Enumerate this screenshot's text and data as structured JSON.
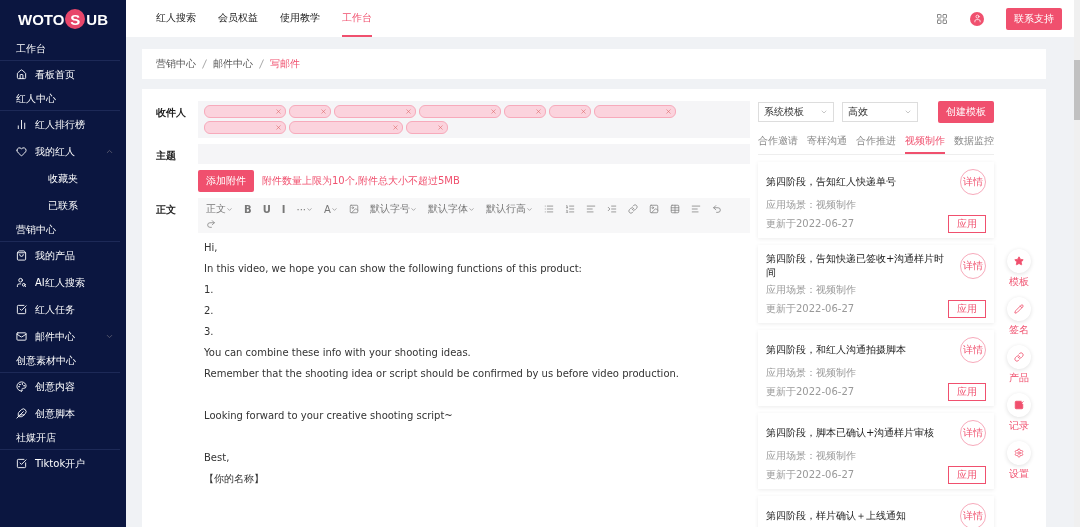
{
  "sidebar": {
    "logo": {
      "before": "WOTO",
      "mark": "S",
      "after": "UB"
    },
    "sections": [
      {
        "title": "工作台",
        "items": [
          {
            "label": "看板首页"
          }
        ]
      },
      {
        "title": "红人中心",
        "items": [
          {
            "label": "红人排行榜"
          },
          {
            "label": "我的红人",
            "expanded": true,
            "children": [
              {
                "label": "收藏夹"
              },
              {
                "label": "已联系"
              }
            ]
          }
        ]
      },
      {
        "title": "营销中心",
        "items": [
          {
            "label": "我的产品"
          },
          {
            "label": "AI红人搜索"
          },
          {
            "label": "红人任务"
          },
          {
            "label": "邮件中心",
            "expanded": false
          }
        ]
      },
      {
        "title": "创意素材中心",
        "items": [
          {
            "label": "创意内容"
          },
          {
            "label": "创意脚本"
          }
        ]
      },
      {
        "title": "社媒开店",
        "items": [
          {
            "label": "Tiktok开户"
          }
        ]
      }
    ]
  },
  "top_nav": {
    "tabs": [
      {
        "label": "红人搜索",
        "selected": false
      },
      {
        "label": "会员权益",
        "selected": false
      },
      {
        "label": "使用教学",
        "selected": false
      },
      {
        "label": "工作台",
        "selected": true
      }
    ],
    "support_button": "联系支持"
  },
  "breadcrumb": [
    "营销中心",
    "邮件中心",
    "写邮件"
  ],
  "form": {
    "recipients_label": "收件人",
    "subject_label": "主题",
    "attach_button": "添加附件",
    "attach_hint": "附件数量上限为10个,附件总大小不超过5MB",
    "body_label": "正文",
    "toolbar": [
      {
        "kind": "drop",
        "label": "正文"
      },
      {
        "kind": "text",
        "label": "B"
      },
      {
        "kind": "text",
        "label": "U"
      },
      {
        "kind": "text",
        "label": "I"
      },
      {
        "kind": "drop",
        "label": "···"
      },
      {
        "kind": "drop",
        "label": "A"
      },
      {
        "kind": "icon"
      },
      {
        "kind": "drop",
        "label": "默认字号"
      },
      {
        "kind": "drop",
        "label": "默认字体"
      },
      {
        "kind": "drop",
        "label": "默认行高"
      },
      {
        "kind": "icon"
      },
      {
        "kind": "icon"
      },
      {
        "kind": "icon"
      },
      {
        "kind": "icon"
      },
      {
        "kind": "icon"
      },
      {
        "kind": "icon"
      },
      {
        "kind": "icon"
      },
      {
        "kind": "icon"
      },
      {
        "kind": "icon"
      },
      {
        "kind": "icon"
      }
    ],
    "body_blocks": [
      [
        "Hi,",
        "In this video, we hope you can show the following functions of this product:",
        "1.",
        "2.",
        "3.",
        "You can combine these info with your shooting ideas.",
        "Remember that the shooting idea or script should be confirmed by us before video production."
      ],
      [
        "Looking forward to your creative shooting script~"
      ],
      [
        "Best,",
        "【你的名称】"
      ]
    ]
  },
  "templates": {
    "filter_1": "系统模板",
    "filter_2": "高效",
    "create_button": "创建模板",
    "tabs": [
      {
        "label": "合作邀请",
        "selected": false
      },
      {
        "label": "寄样沟通",
        "selected": false
      },
      {
        "label": "合作推进",
        "selected": false
      },
      {
        "label": "视频制作",
        "selected": true
      },
      {
        "label": "数据监控",
        "selected": false
      }
    ],
    "cards": [
      {
        "title": "第四阶段，告知红人快递单号",
        "badge": "详情",
        "scene": "应用场景：视频制作",
        "updated": "更新于2022-06-27",
        "apply": "应用"
      },
      {
        "title": "第四阶段，告知快递已签收+沟通样片时间",
        "badge": "详情",
        "scene": "应用场景：视频制作",
        "updated": "更新于2022-06-27",
        "apply": "应用"
      },
      {
        "title": "第四阶段，和红人沟通拍摄脚本",
        "badge": "详情",
        "scene": "应用场景：视频制作",
        "updated": "更新于2022-06-27",
        "apply": "应用"
      },
      {
        "title": "第四阶段，脚本已确认+沟通样片审核",
        "badge": "详情",
        "scene": "应用场景：视频制作",
        "updated": "更新于2022-06-27",
        "apply": "应用"
      },
      {
        "title": "第四阶段，样片确认＋上线通知",
        "badge": "详情"
      }
    ]
  },
  "quick_tools": [
    {
      "label": "模板"
    },
    {
      "label": "签名"
    },
    {
      "label": "产品"
    },
    {
      "label": "记录"
    },
    {
      "label": "设置"
    }
  ]
}
